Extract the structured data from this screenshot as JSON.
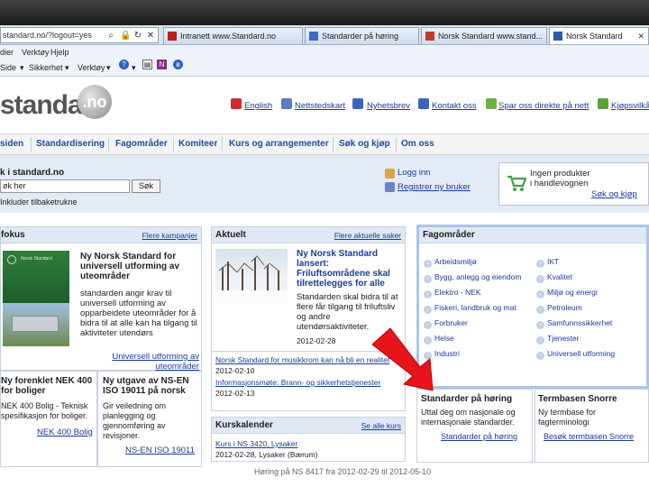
{
  "browser": {
    "url": "standard.no/?logout=yes",
    "tabs": [
      {
        "label": "Intranett www.Standard.no",
        "active": false
      },
      {
        "label": "Standarder på høring",
        "active": false
      },
      {
        "label": "Norsk Standard www.stand...",
        "active": false
      },
      {
        "label": "Norsk Standard",
        "active": true
      }
    ],
    "menu": [
      "dier",
      "Verktøy",
      "Hjelp"
    ],
    "commands": [
      "Side",
      "Sikkerhet",
      "Verktøy"
    ]
  },
  "site": {
    "logo_text": "standard",
    "logo_ball": ".no",
    "top_links": [
      "English",
      "Nettstedskart",
      "Nyhetsbrev",
      "Kontakt oss",
      "Spar oss direkte på nett",
      "Kjøpsvilkår"
    ],
    "nav": [
      "siden",
      "Standardisering",
      "Fagområder",
      "Komiteer",
      "Kurs og arrangementer",
      "Søk og kjøp",
      "Om oss"
    ],
    "search": {
      "label": "k i standard.no",
      "value": "øk her",
      "button": "Søk",
      "include_expired": "Inkluder tilbaketrukne"
    },
    "login": {
      "login_label": "Logg inn",
      "register_label": "Registrer ny bruker"
    },
    "cart": {
      "text_line1": "Ingen produkter",
      "text_line2": "i handlevognen",
      "link": "Søk og kjøp"
    }
  },
  "fokus": {
    "title": "fokus",
    "more": "Flere kampanjer",
    "headline": "Ny Norsk Standard for universell utforming av uteområder",
    "body": "standarden angir krav til universell utforming av opparbeidete uteområder for å bidra til at alle kan ha tilgang til aktiviteter utendørs",
    "link": "Universell utforming av uteområder",
    "thumb_text": "Norsk Standard"
  },
  "aktuelt": {
    "title": "Aktuelt",
    "more": "Flere aktuelle saker",
    "headline": "Ny Norsk Standard lansert: Friluftsområdene skal tilrettelegges for alle",
    "body": "Standarden skal bidra til at flere får tilgang til friluftsliv og andre utendørsaktiviteter.",
    "date1": "2012-02-28",
    "item2": "Norsk Standard for musikkrom kan nå bli en realitet",
    "date2": "2012-02-10",
    "item3": "Informasjonsmøte: Brann- og sikkerhetstjenester",
    "date3": "2012-02-13"
  },
  "nek": {
    "title": "Ny forenklet NEK 400 for boliger",
    "body": "NEK 400 Bolig - Teknisk spesifikasjon for boliger.",
    "link": "NEK 400 Bolig"
  },
  "iso": {
    "title": "Ny utgave av NS-EN ISO 19011 på norsk",
    "body": "Gir veiledning om planlegging og gjennomføring av revisjoner.",
    "link": "NS-EN ISO 19011"
  },
  "kurskalender": {
    "title": "Kurskalender",
    "more": "Se alle kurs",
    "item": "Kurs i NS 3420, Lysaker",
    "date": "2012-02-28, Lysaker (Bærum)"
  },
  "fagomrader": {
    "title": "Fagområder",
    "left": [
      "Arbeidsmiljø",
      "Bygg, anlegg og eiendom",
      "Elektro - NEK",
      "Fiskeri, landbruk og mat",
      "Forbruker",
      "Helse",
      "Industri"
    ],
    "right": [
      "IKT",
      "Kvalitet",
      "Miljø og energi",
      "Petroleum",
      "Samfunnssikkerhet",
      "Tjenester",
      "Universell utforming"
    ]
  },
  "horing": {
    "title": "Standarder på høring",
    "body": "Uttal deg om nasjonale og internasjonale standarder.",
    "link": "Standarder på høring"
  },
  "snorre": {
    "title": "Termbasen Snorre",
    "body": "Ny termbase for fagterminologi",
    "link": "Besøk termbasen Snorre"
  },
  "footer_text": "Høring på NS 8417 fra 2012-02-29 til 2012-05-10",
  "colors": {
    "link": "#1a3b9a",
    "nav": "#1a4d9c",
    "arrow": "#e8141c",
    "panel_head": "#dfe8f4",
    "band": "#e3ebf5"
  }
}
